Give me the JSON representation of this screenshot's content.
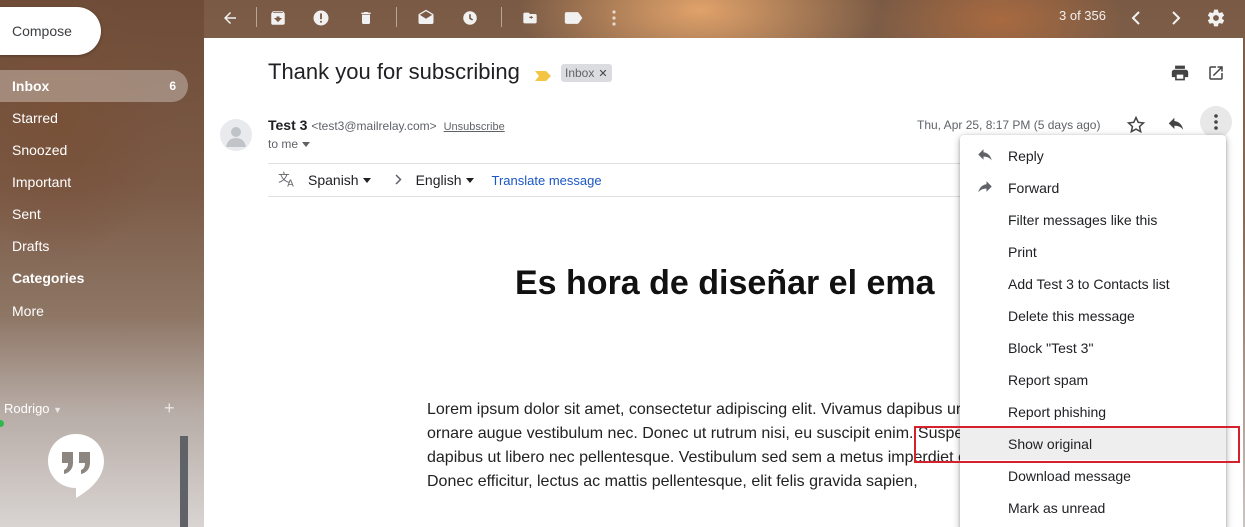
{
  "compose": {
    "label": "Compose"
  },
  "toolbar": {
    "icons": [
      "back-arrow-icon",
      "archive-icon",
      "report-spam-icon",
      "delete-icon",
      "mark-unread-icon",
      "snooze-icon",
      "move-to-icon",
      "label-icon",
      "more-vert-icon"
    ],
    "pager": "3 of 356"
  },
  "sidebar": {
    "items": [
      {
        "label": "Inbox",
        "count": "6"
      },
      {
        "label": "Starred"
      },
      {
        "label": "Snoozed"
      },
      {
        "label": "Important"
      },
      {
        "label": "Sent"
      },
      {
        "label": "Drafts"
      },
      {
        "label": "Categories"
      },
      {
        "label": "More"
      }
    ],
    "hangouts_user": "Rodrigo"
  },
  "message": {
    "subject": "Thank you for subscribing",
    "label": "Inbox",
    "sender_name": "Test 3",
    "sender_email": "<test3@mailrelay.com>",
    "unsubscribe": "Unsubscribe",
    "to": "to me",
    "date": "Thu, Apr 25, 8:17 PM (5 days ago)",
    "translate": {
      "from": "Spanish",
      "to": "English",
      "action": "Translate message"
    },
    "headline": "Es hora de diseñar el ema",
    "body_lines": [
      "Lorem ipsum dolor sit amet, consectetur adipiscing elit. Vivamus dapibus ur",
      "ornare augue vestibulum nec. Donec ut rutrum nisi, eu suscipit enim. Suspe",
      "dapibus ut libero nec pellentesque. Vestibulum sed sem a metus imperdiet e",
      "Donec efficitur, lectus ac mattis pellentesque, elit felis gravida sapien,"
    ]
  },
  "menu": {
    "items": [
      {
        "label": "Reply",
        "icon": "reply-icon"
      },
      {
        "label": "Forward",
        "icon": "forward-icon"
      },
      {
        "label": "Filter messages like this"
      },
      {
        "label": "Print"
      },
      {
        "label": "Add Test 3 to Contacts list"
      },
      {
        "label": "Delete this message"
      },
      {
        "label": "Block \"Test 3\""
      },
      {
        "label": "Report spam"
      },
      {
        "label": "Report phishing"
      },
      {
        "label": "Show original"
      },
      {
        "label": "Download message"
      },
      {
        "label": "Mark as unread"
      }
    ],
    "highlighted": "Show original"
  },
  "colors": {
    "highlight_border": "#d4212b",
    "link_blue": "#1a56c4",
    "important_marker": "#f4c542"
  }
}
